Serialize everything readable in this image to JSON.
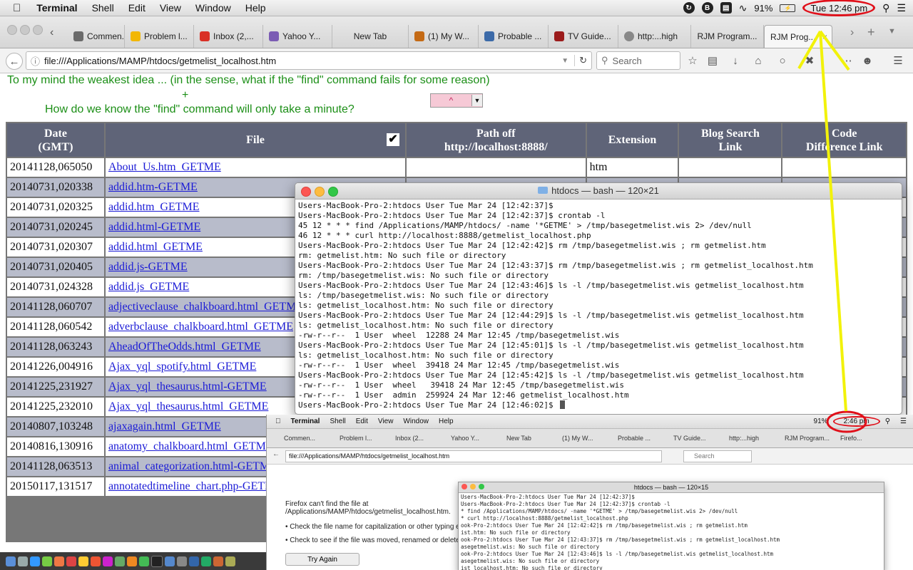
{
  "menubar": {
    "app_name": "Terminal",
    "items": [
      "Shell",
      "Edit",
      "View",
      "Window",
      "Help"
    ],
    "status": {
      "battery": "91%",
      "clock": "Tue 12:46 pm"
    }
  },
  "tabs": [
    {
      "label": "Commen...",
      "icon_color": "#6a6a6a"
    },
    {
      "label": "Problem l...",
      "icon_color": "#f2b705"
    },
    {
      "label": "Inbox (2,...",
      "icon_color": "#d93025"
    },
    {
      "label": "Yahoo Y...",
      "icon_color": "#7b5cb4"
    },
    {
      "label": "New Tab",
      "icon_color": ""
    },
    {
      "label": "(1) My W...",
      "icon_color": "#c46a15"
    },
    {
      "label": "Probable ...",
      "icon_color": "#3c6aa8"
    },
    {
      "label": "TV Guide...",
      "icon_color": "#9b1b1b"
    },
    {
      "label": "http:...high",
      "icon_color": "#888888"
    },
    {
      "label": "RJM Program...",
      "icon_color": ""
    },
    {
      "label": "RJM Prog...",
      "icon_color": ""
    }
  ],
  "nav": {
    "url": "file:///Applications/MAMP/htdocs/getmelist_localhost.htm",
    "search_placeholder": "Search"
  },
  "page": {
    "line1": "To my mind the weakest idea ... (in the sense, what if the \"find\" command fails for some reason)",
    "plus": "+",
    "line2": "How do we know the \"find\" command will only take a minute?",
    "select_value": "^",
    "headers": [
      "Date\n(GMT)",
      "File",
      "Path off\nhttp://localhost:8888/",
      "Extension",
      "Blog Search\nLink",
      "Code\nDifference Link"
    ],
    "rows": [
      {
        "date": "20141128,065050",
        "file": "About_Us.htm_GETME",
        "ext": "htm"
      },
      {
        "date": "20140731,020338",
        "file": "addid.htm-GETME",
        "ext": ""
      },
      {
        "date": "20140731,020325",
        "file": "addid.htm_GETME",
        "ext": ""
      },
      {
        "date": "20140731,020245",
        "file": "addid.html-GETME",
        "ext": ""
      },
      {
        "date": "20140731,020307",
        "file": "addid.html_GETME",
        "ext": ""
      },
      {
        "date": "20140731,020405",
        "file": "addid.js-GETME",
        "ext": ""
      },
      {
        "date": "20140731,024328",
        "file": "addid.js_GETME",
        "ext": ""
      },
      {
        "date": "20141128,060707",
        "file": "adjectiveclause_chalkboard.html_GETME",
        "ext": ""
      },
      {
        "date": "20141128,060542",
        "file": "adverbclause_chalkboard.html_GETME",
        "ext": ""
      },
      {
        "date": "20141128,063243",
        "file": "AheadOfTheOdds.html_GETME",
        "ext": ""
      },
      {
        "date": "20141226,004916",
        "file": "Ajax_yql_spotify.html_GETME",
        "ext": ""
      },
      {
        "date": "20141225,231927",
        "file": "Ajax_yql_thesaurus.html-GETME",
        "ext": ""
      },
      {
        "date": "20141225,232010",
        "file": "Ajax_yql_thesaurus.html_GETME",
        "ext": ""
      },
      {
        "date": "20140807,103248",
        "file": "ajaxagain.html_GETME",
        "ext": ""
      },
      {
        "date": "20140816,130916",
        "file": "anatomy_chalkboard.html_GETME",
        "ext": ""
      },
      {
        "date": "20141128,063513",
        "file": "animal_categorization.html-GETME",
        "ext": ""
      },
      {
        "date": "20150117,131517",
        "file": "annotatedtimeline_chart.php-GETME",
        "ext": ""
      }
    ]
  },
  "terminal": {
    "title": "htdocs — bash — 120×21",
    "lines": [
      "Users-MacBook-Pro-2:htdocs User Tue Mar 24 [12:42:37]$",
      "Users-MacBook-Pro-2:htdocs User Tue Mar 24 [12:42:37]$ crontab -l",
      "45 12 * * * find /Applications/MAMP/htdocs/ -name '*GETME' > /tmp/basegetmelist.wis 2> /dev/null",
      "46 12 * * * curl http://localhost:8888/getmelist_localhost.php",
      "Users-MacBook-Pro-2:htdocs User Tue Mar 24 [12:42:42]$ rm /tmp/basegetmelist.wis ; rm getmelist.htm",
      "rm: getmelist.htm: No such file or directory",
      "Users-MacBook-Pro-2:htdocs User Tue Mar 24 [12:43:37]$ rm /tmp/basegetmelist.wis ; rm getmelist_localhost.htm",
      "rm: /tmp/basegetmelist.wis: No such file or directory",
      "Users-MacBook-Pro-2:htdocs User Tue Mar 24 [12:43:46]$ ls -l /tmp/basegetmelist.wis getmelist_localhost.htm",
      "ls: /tmp/basegetmelist.wis: No such file or directory",
      "ls: getmelist_localhost.htm: No such file or directory",
      "Users-MacBook-Pro-2:htdocs User Tue Mar 24 [12:44:29]$ ls -l /tmp/basegetmelist.wis getmelist_localhost.htm",
      "ls: getmelist_localhost.htm: No such file or directory",
      "-rw-r--r--  1 User  wheel  12288 24 Mar 12:45 /tmp/basegetmelist.wis",
      "Users-MacBook-Pro-2:htdocs User Tue Mar 24 [12:45:01]$ ls -l /tmp/basegetmelist.wis getmelist_localhost.htm",
      "ls: getmelist_localhost.htm: No such file or directory",
      "-rw-r--r--  1 User  wheel  39418 24 Mar 12:45 /tmp/basegetmelist.wis",
      "Users-MacBook-Pro-2:htdocs User Tue Mar 24 [12:45:42]$ ls -l /tmp/basegetmelist.wis getmelist_localhost.htm",
      "-rw-r--r--  1 User  wheel   39418 24 Mar 12:45 /tmp/basegetmelist.wis",
      "-rw-r--r--  1 User  admin  259924 24 Mar 12:46 getmelist_localhost.htm",
      "Users-MacBook-Pro-2:htdocs User Tue Mar 24 [12:46:02]$ "
    ]
  },
  "inset": {
    "menubar": {
      "app_name": "Terminal",
      "items": [
        "Shell",
        "Edit",
        "View",
        "Window",
        "Help"
      ],
      "battery": "91%",
      "clock": "2:46 pm"
    },
    "tabs": [
      "Commen...",
      "Problem l...",
      "Inbox (2...",
      "Yahoo Y...",
      "New Tab",
      "(1) My W...",
      "Probable ...",
      "TV Guide...",
      "http:...high",
      "RJM Program...",
      "Firefo..."
    ],
    "url": "file:///Applications/MAMP/htdocs/getmelist_localhost.htm",
    "search_placeholder": "Search",
    "error_title": "Firefox can't find the file at /Applications/MAMP/htdocs/getmelist_localhost.htm.",
    "bullet1": "Check the file name for capitalization or other typing errors.",
    "bullet2": "Check to see if the file was moved, renamed or deleted.",
    "try_again": "Try Again",
    "terminal_title": "htdocs — bash — 120×15",
    "terminal_lines": [
      "Users-MacBook-Pro-2:htdocs User Tue Mar 24 [12:42:37]$",
      "Users-MacBook-Pro-2:htdocs User Tue Mar 24 [12:42:37]$ crontab -l",
      "* find /Applications/MAMP/htdocs/ -name '*GETME' > /tmp/basegetmelist.wis 2> /dev/null",
      "* curl http://localhost:8888/getmelist_localhost.php",
      "ook-Pro-2:htdocs User Tue Mar 24 [12:42:42]$ rm /tmp/basegetmelist.wis ; rm getmelist.htm",
      "ist.htm: No such file or directory",
      "ook-Pro-2:htdocs User Tue Mar 24 [12:43:37]$ rm /tmp/basegetmelist.wis ; rm getmelist_localhost.htm",
      "asegetmelist.wis: No such file or directory",
      "ook-Pro-2:htdocs User Tue Mar 24 [12:43:46]$ ls -l /tmp/basegetmelist.wis getmelist_localhost.htm",
      "asegetmelist.wis: No such file or directory",
      "ist_localhost.htm: No such file or directory"
    ]
  },
  "annotation": {
    "ring_color": "#e0101a",
    "arrow_color": "#f2f20a"
  }
}
